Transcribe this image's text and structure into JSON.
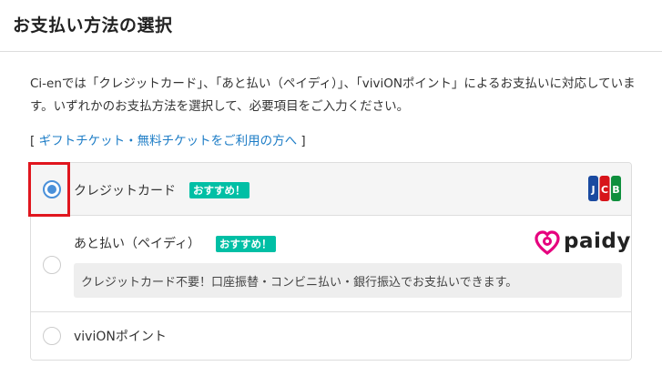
{
  "header": {
    "title": "お支払い方法の選択"
  },
  "intro": {
    "text": "Ci-enでは「クレジットカード」、「あと払い（ペイディ）」、「viviONポイント」によるお支払いに対応しています。いずれかのお支払方法を選択して、必要項目をご入力ください。"
  },
  "gift": {
    "open_bracket": "[",
    "link_label": "ギフトチケット・無料チケットをご利用の方へ",
    "close_bracket": "]"
  },
  "payment_options": [
    {
      "label": "クレジットカード",
      "badge": "おすすめ！",
      "selected": true,
      "logo": "jcb-logo"
    },
    {
      "label": "あと払い（ペイディ）",
      "badge": "おすすめ！",
      "selected": false,
      "logo": "paidy-logo",
      "logo_text": "paidy",
      "description": "クレジットカード不要！口座振替・コンビニ払い・銀行振込でお支払いできます。"
    },
    {
      "label": "viviONポイント",
      "selected": false
    }
  ],
  "colors": {
    "accent_blue": "#4a90d9",
    "badge_teal": "#00bfa5",
    "link_blue": "#1c7cc6",
    "highlight_red": "#e0161e",
    "paidy_pink": "#e6007e"
  }
}
